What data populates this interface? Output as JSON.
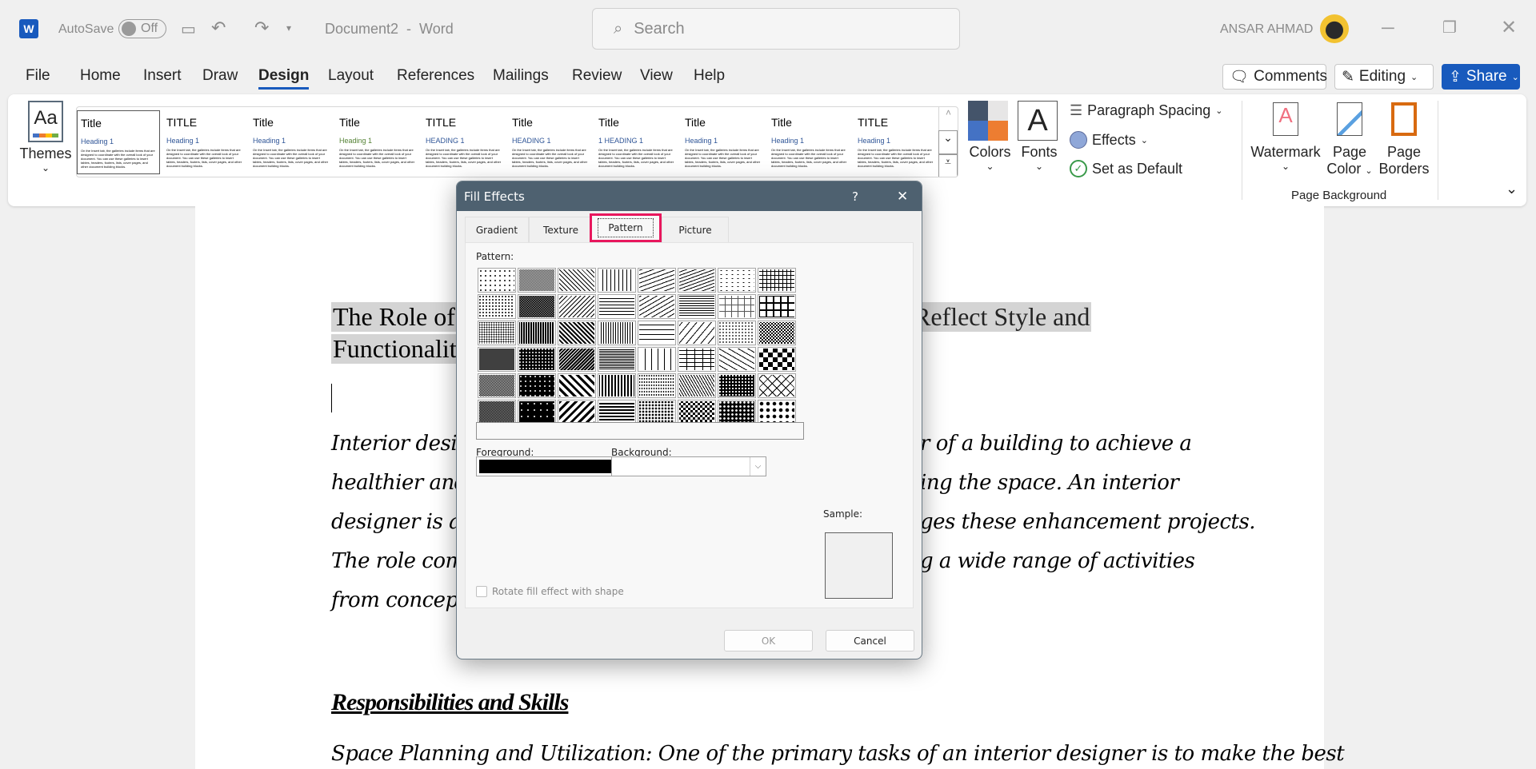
{
  "titlebar": {
    "autosave_label": "AutoSave",
    "autosave_state": "Off",
    "document_title": "Document2  -  Word",
    "search_placeholder": "Search",
    "user_name": "ANSAR AHMAD"
  },
  "menu": [
    "File",
    "Home",
    "Insert",
    "Draw",
    "Design",
    "Layout",
    "References",
    "Mailings",
    "Review",
    "View",
    "Help"
  ],
  "active_menu": "Design",
  "actions": {
    "comments": "Comments",
    "editing": "Editing",
    "share": "Share"
  },
  "ribbon": {
    "themes_label": "Themes",
    "gallery_body": "On the Insert tab, the galleries include items that are designed to coordinate with the overall look of your document. You can use these galleries to insert tables, headers, footers, lists, cover pages, and other document building blocks.",
    "gallery": [
      {
        "title": "Title",
        "heading": "Heading 1"
      },
      {
        "title": "TITLE",
        "heading": "Heading 1"
      },
      {
        "title": "Title",
        "heading": "Heading 1"
      },
      {
        "title": "Title",
        "heading": "Heading 1"
      },
      {
        "title": "TITLE",
        "heading": "HEADING 1"
      },
      {
        "title": "Title",
        "heading": "HEADING 1"
      },
      {
        "title": "Title",
        "heading": "1  HEADING 1"
      },
      {
        "title": "Title",
        "heading": "Heading 1"
      },
      {
        "title": "Title",
        "heading": "Heading 1"
      },
      {
        "title": "TITLE",
        "heading": "Heading 1"
      }
    ],
    "colors_label": "Colors",
    "fonts_label": "Fonts",
    "paragraph_spacing": "Paragraph Spacing",
    "effects": "Effects",
    "set_default": "Set as Default",
    "watermark": "Watermark",
    "page_color_1": "Page",
    "page_color_2": "Color",
    "page_borders_1": "Page",
    "page_borders_2": "Borders",
    "group_label": "Page Background"
  },
  "document": {
    "title_line1_left": "The Role of",
    "title_line1_right": "Reflect Style and",
    "title_line2": "Functionalit",
    "body_left": [
      "Interior design",
      "healthier and m",
      "designer is a p",
      "The role combi",
      "from conceptua"
    ],
    "body_right": [
      "r of a building to achieve a",
      "ing the space. An interior",
      "ges these enhancement projects.",
      "g a wide range of activities",
      ""
    ],
    "heading": "Responsibilities and Skills",
    "para2": "Space Planning and Utilization: One of the primary tasks of an interior designer is to make the best"
  },
  "dialog": {
    "title": "Fill Effects",
    "help": "?",
    "tabs": [
      "Gradient",
      "Texture",
      "Pattern",
      "Picture"
    ],
    "active_tab": "Pattern",
    "pattern_label": "Pattern:",
    "foreground_label": "Foreground:",
    "background_label": "Background:",
    "foreground_color": "#000000",
    "background_color": "#ffffff",
    "rotate_label": "Rotate fill effect with shape",
    "sample_label": "Sample:",
    "ok": "OK",
    "cancel": "Cancel",
    "highlight_color": "#e8175d"
  }
}
